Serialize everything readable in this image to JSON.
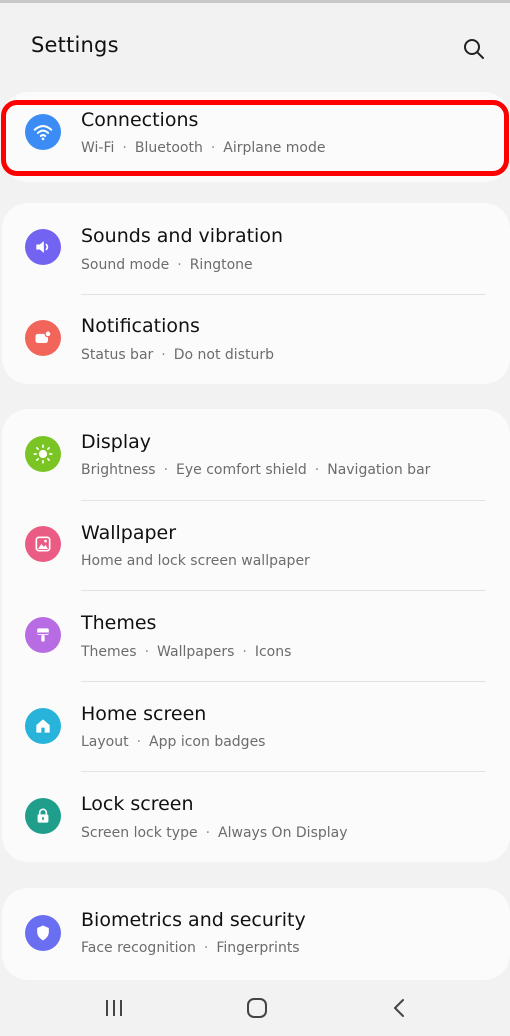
{
  "header": {
    "title": "Settings",
    "search_icon": "search-icon"
  },
  "sections": [
    {
      "items": [
        {
          "label": "Connections",
          "sub": [
            "Wi-Fi",
            "Bluetooth",
            "Airplane mode"
          ],
          "icon": "wifi-icon",
          "color": "#3b8df5"
        }
      ]
    },
    {
      "items": [
        {
          "label": "Sounds and vibration",
          "sub": [
            "Sound mode",
            "Ringtone"
          ],
          "icon": "speaker-icon",
          "color": "#7264f0"
        },
        {
          "label": "Notifications",
          "sub": [
            "Status bar",
            "Do not disturb"
          ],
          "icon": "notification-icon",
          "color": "#f1655a"
        }
      ]
    },
    {
      "items": [
        {
          "label": "Display",
          "sub": [
            "Brightness",
            "Eye comfort shield",
            "Navigation bar"
          ],
          "icon": "sun-icon",
          "color": "#7ac424"
        },
        {
          "label": "Wallpaper",
          "sub": [
            "Home and lock screen wallpaper"
          ],
          "icon": "image-icon",
          "color": "#ea5c83"
        },
        {
          "label": "Themes",
          "sub": [
            "Themes",
            "Wallpapers",
            "Icons"
          ],
          "icon": "brush-icon",
          "color": "#b86ce3"
        },
        {
          "label": "Home screen",
          "sub": [
            "Layout",
            "App icon badges"
          ],
          "icon": "home-icon",
          "color": "#27b3da"
        },
        {
          "label": "Lock screen",
          "sub": [
            "Screen lock type",
            "Always On Display"
          ],
          "icon": "lock-icon",
          "color": "#1f9e8c"
        }
      ]
    },
    {
      "items": [
        {
          "label": "Biometrics and security",
          "sub": [
            "Face recognition",
            "Fingerprints"
          ],
          "icon": "shield-icon",
          "color": "#6a6ef0"
        }
      ]
    }
  ],
  "navbar": {
    "recents": "recents-icon",
    "home": "home-button-icon",
    "back": "back-icon"
  }
}
